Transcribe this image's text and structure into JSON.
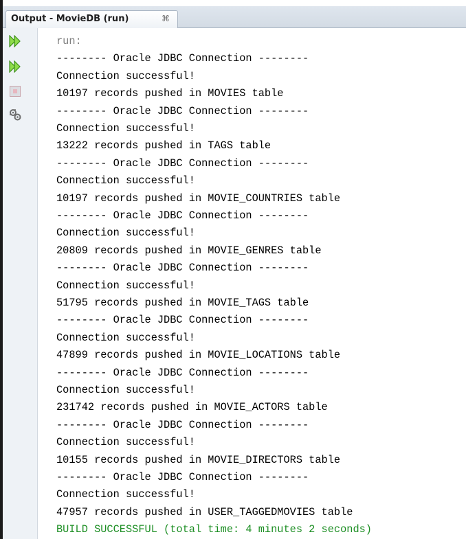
{
  "tab": {
    "title": "Output - MovieDB (run)",
    "close_glyph": "⌘"
  },
  "toolbar": {
    "items": [
      {
        "name": "rerun-icon",
        "label": "Re-run"
      },
      {
        "name": "rerun-with-params-icon",
        "label": "Re-run with different parameters"
      },
      {
        "name": "stop-icon",
        "label": "Stop"
      },
      {
        "name": "settings-icon",
        "label": "Settings"
      }
    ]
  },
  "colors": {
    "run_text": "#808080",
    "success_text": "#1c8e23",
    "play_green": "#5cbf2a"
  },
  "output": {
    "lines": [
      {
        "text": "run:",
        "kind": "run"
      },
      {
        "text": "-------- Oracle JDBC Connection --------",
        "kind": "normal"
      },
      {
        "text": "Connection successful!",
        "kind": "normal"
      },
      {
        "text": "10197 records pushed in MOVIES table",
        "kind": "normal"
      },
      {
        "text": "-------- Oracle JDBC Connection --------",
        "kind": "normal"
      },
      {
        "text": "Connection successful!",
        "kind": "normal"
      },
      {
        "text": "13222 records pushed in TAGS table",
        "kind": "normal"
      },
      {
        "text": "-------- Oracle JDBC Connection --------",
        "kind": "normal"
      },
      {
        "text": "Connection successful!",
        "kind": "normal"
      },
      {
        "text": "10197 records pushed in MOVIE_COUNTRIES table",
        "kind": "normal"
      },
      {
        "text": "-------- Oracle JDBC Connection --------",
        "kind": "normal"
      },
      {
        "text": "Connection successful!",
        "kind": "normal"
      },
      {
        "text": "20809 records pushed in MOVIE_GENRES table",
        "kind": "normal"
      },
      {
        "text": "-------- Oracle JDBC Connection --------",
        "kind": "normal"
      },
      {
        "text": "Connection successful!",
        "kind": "normal"
      },
      {
        "text": "51795 records pushed in MOVIE_TAGS table",
        "kind": "normal"
      },
      {
        "text": "-------- Oracle JDBC Connection --------",
        "kind": "normal"
      },
      {
        "text": "Connection successful!",
        "kind": "normal"
      },
      {
        "text": "47899 records pushed in MOVIE_LOCATIONS table",
        "kind": "normal"
      },
      {
        "text": "-------- Oracle JDBC Connection --------",
        "kind": "normal"
      },
      {
        "text": "Connection successful!",
        "kind": "normal"
      },
      {
        "text": "231742 records pushed in MOVIE_ACTORS table",
        "kind": "normal"
      },
      {
        "text": "-------- Oracle JDBC Connection --------",
        "kind": "normal"
      },
      {
        "text": "Connection successful!",
        "kind": "normal"
      },
      {
        "text": "10155 records pushed in MOVIE_DIRECTORS table",
        "kind": "normal"
      },
      {
        "text": "-------- Oracle JDBC Connection --------",
        "kind": "normal"
      },
      {
        "text": "Connection successful!",
        "kind": "normal"
      },
      {
        "text": "47957 records pushed in USER_TAGGEDMOVIES table",
        "kind": "normal"
      },
      {
        "text": "BUILD SUCCESSFUL (total time: 4 minutes 2 seconds)",
        "kind": "success"
      }
    ]
  }
}
